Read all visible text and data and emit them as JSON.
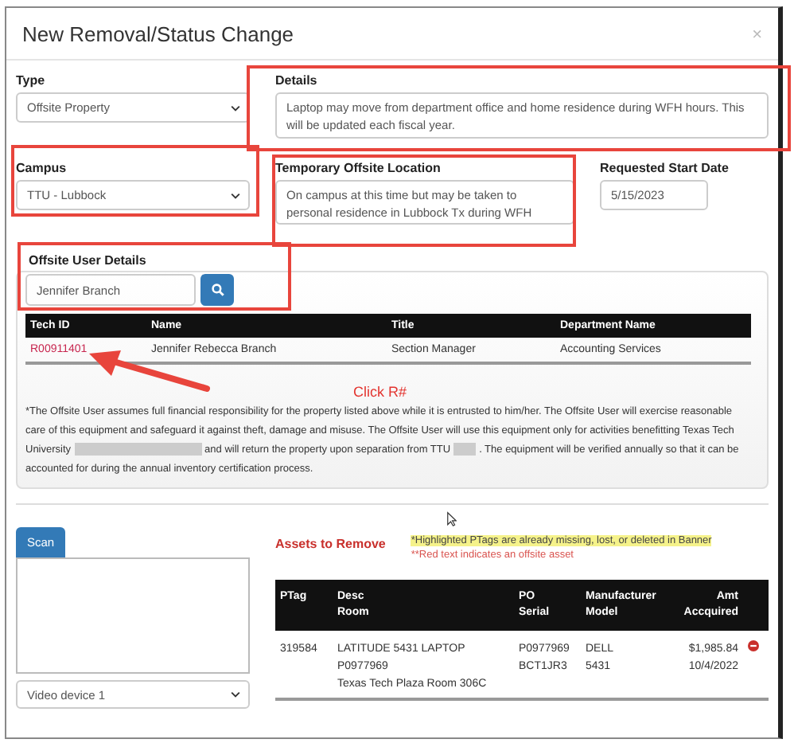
{
  "window": {
    "title": "New Removal/Status Change",
    "close": "×"
  },
  "type": {
    "label": "Type",
    "value": "Offsite Property"
  },
  "details": {
    "label": "Details",
    "value": "Laptop may move from department office and home residence during WFH hours. This will be updated each fiscal year."
  },
  "campus": {
    "label": "Campus",
    "value": "TTU - Lubbock"
  },
  "location": {
    "label": "Temporary Offsite Location",
    "value": "On campus at this time but may be taken to personal residence in Lubbock Tx during WFH"
  },
  "start_date": {
    "label": "Requested Start Date",
    "value": "5/15/2023"
  },
  "offsite_user": {
    "label": "Offsite User Details",
    "value": "Jennifer Branch",
    "columns": [
      "Tech ID",
      "Name",
      "Title",
      "Department Name"
    ],
    "rows": [
      {
        "tech_id": "R00911401",
        "name": "Jennifer Rebecca Branch",
        "title": "Section Manager",
        "department": "Accounting Services"
      }
    ],
    "callout": "Click R#",
    "notice_parts": [
      "*The Offsite User assumes full financial responsibility for the property listed above while it is entrusted to him/her. The Offsite User will exercise reasonable care of this equipment and safeguard it against theft, damage and misuse. The Offsite User will use this equipment only for activities benefitting Texas Tech University",
      "and will return the property upon separation from TTU",
      ". The equipment will be verified annually so that it can be accounted for during the annual inventory certification process."
    ]
  },
  "scanner": {
    "button": "Scan",
    "device": "Video device 1"
  },
  "assets": {
    "heading": "Assets to Remove",
    "note_highlight": "*Highlighted PTags are already missing, lost, or deleted in Banner",
    "note_red": "**Red text indicates an offsite asset",
    "columns": [
      "PTag",
      "Desc Room",
      "PO Serial",
      "Manufacturer Model",
      "Amt Accquired"
    ],
    "rows": [
      {
        "cells": [
          [
            "319584"
          ],
          [
            "LATITUDE 5431 LAPTOP",
            "P0977969",
            "Texas Tech Plaza Room 306C"
          ],
          [
            "P0977969",
            "BCT1JR3"
          ],
          [
            "DELL",
            "5431"
          ],
          [
            "$1,985.84",
            "10/4/2022"
          ]
        ]
      }
    ]
  }
}
